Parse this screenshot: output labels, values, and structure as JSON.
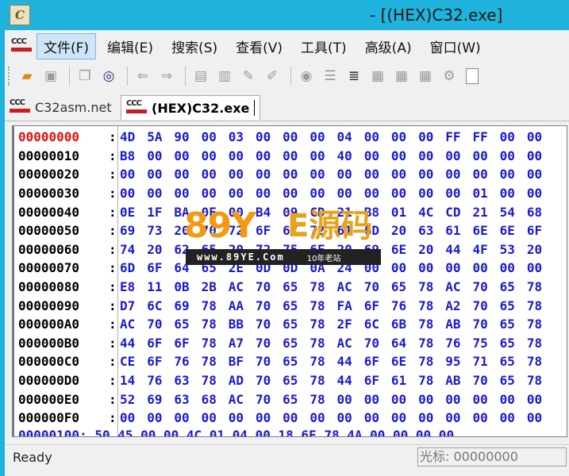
{
  "window": {
    "title": "- [(HEX)C32.exe]",
    "icon": "app-icon"
  },
  "menu": {
    "items": [
      "文件(F)",
      "编辑(E)",
      "搜索(S)",
      "查看(V)",
      "工具(T)",
      "高级(A)",
      "窗口(W)"
    ],
    "active_index": 0
  },
  "toolbar": {
    "icons": [
      "open-folder-icon",
      "save-icon",
      "copy-icon",
      "binoculars-icon",
      "back-arrow-icon",
      "forward-arrow-icon",
      "page-icon",
      "page-icon",
      "tools-icon",
      "tools-icon",
      "clipboard-icon",
      "list-icon",
      "align-icon",
      "grid-icon",
      "grid-icon",
      "grid-icon",
      "gear-icon"
    ]
  },
  "tabs": [
    {
      "label": "C32asm.net",
      "active": false
    },
    {
      "label": "(HEX)C32.exe",
      "active": true
    }
  ],
  "hex": {
    "rows": [
      {
        "addr": "00000000",
        "bytes": [
          "4D",
          "5A",
          "90",
          "00",
          "03",
          "00",
          "00",
          "00",
          "04",
          "00",
          "00",
          "00",
          "FF",
          "FF",
          "00",
          "00"
        ]
      },
      {
        "addr": "00000010",
        "bytes": [
          "B8",
          "00",
          "00",
          "00",
          "00",
          "00",
          "00",
          "00",
          "40",
          "00",
          "00",
          "00",
          "00",
          "00",
          "00",
          "00"
        ]
      },
      {
        "addr": "00000020",
        "bytes": [
          "00",
          "00",
          "00",
          "00",
          "00",
          "00",
          "00",
          "00",
          "00",
          "00",
          "00",
          "00",
          "00",
          "00",
          "00",
          "00"
        ]
      },
      {
        "addr": "00000030",
        "bytes": [
          "00",
          "00",
          "00",
          "00",
          "00",
          "00",
          "00",
          "00",
          "00",
          "00",
          "00",
          "00",
          "00",
          "01",
          "00",
          "00"
        ]
      },
      {
        "addr": "00000040",
        "bytes": [
          "0E",
          "1F",
          "BA",
          "0E",
          "00",
          "B4",
          "09",
          "CD",
          "21",
          "B8",
          "01",
          "4C",
          "CD",
          "21",
          "54",
          "68"
        ]
      },
      {
        "addr": "00000050",
        "bytes": [
          "69",
          "73",
          "20",
          "70",
          "72",
          "6F",
          "67",
          "72",
          "61",
          "6D",
          "20",
          "63",
          "61",
          "6E",
          "6E",
          "6F"
        ]
      },
      {
        "addr": "00000060",
        "bytes": [
          "74",
          "20",
          "62",
          "65",
          "20",
          "72",
          "75",
          "6E",
          "20",
          "69",
          "6E",
          "20",
          "44",
          "4F",
          "53",
          "20"
        ]
      },
      {
        "addr": "00000070",
        "bytes": [
          "6D",
          "6F",
          "64",
          "65",
          "2E",
          "0D",
          "0D",
          "0A",
          "24",
          "00",
          "00",
          "00",
          "00",
          "00",
          "00",
          "00"
        ]
      },
      {
        "addr": "00000080",
        "bytes": [
          "E8",
          "11",
          "0B",
          "2B",
          "AC",
          "70",
          "65",
          "78",
          "AC",
          "70",
          "65",
          "78",
          "AC",
          "70",
          "65",
          "78"
        ]
      },
      {
        "addr": "00000090",
        "bytes": [
          "D7",
          "6C",
          "69",
          "78",
          "AA",
          "70",
          "65",
          "78",
          "FA",
          "6F",
          "76",
          "78",
          "A2",
          "70",
          "65",
          "78"
        ]
      },
      {
        "addr": "000000A0",
        "bytes": [
          "AC",
          "70",
          "65",
          "78",
          "BB",
          "70",
          "65",
          "78",
          "2F",
          "6C",
          "6B",
          "78",
          "AB",
          "70",
          "65",
          "78"
        ]
      },
      {
        "addr": "000000B0",
        "bytes": [
          "44",
          "6F",
          "6F",
          "78",
          "A7",
          "70",
          "65",
          "78",
          "AC",
          "70",
          "64",
          "78",
          "76",
          "75",
          "65",
          "78"
        ]
      },
      {
        "addr": "000000C0",
        "bytes": [
          "CE",
          "6F",
          "76",
          "78",
          "BF",
          "70",
          "65",
          "78",
          "44",
          "6F",
          "6E",
          "78",
          "95",
          "71",
          "65",
          "78"
        ]
      },
      {
        "addr": "000000D0",
        "bytes": [
          "14",
          "76",
          "63",
          "78",
          "AD",
          "70",
          "65",
          "78",
          "44",
          "6F",
          "61",
          "78",
          "AB",
          "70",
          "65",
          "78"
        ]
      },
      {
        "addr": "000000E0",
        "bytes": [
          "52",
          "69",
          "63",
          "68",
          "AC",
          "70",
          "65",
          "78",
          "00",
          "00",
          "00",
          "00",
          "00",
          "00",
          "00",
          "00"
        ]
      },
      {
        "addr": "000000F0",
        "bytes": [
          "00",
          "00",
          "00",
          "00",
          "00",
          "00",
          "00",
          "00",
          "00",
          "00",
          "00",
          "00",
          "00",
          "00",
          "00",
          "00"
        ]
      }
    ],
    "partial_row": "00000100: 50 45 00 00 4C 01 04 00 18 6F 78 4A 00 00 00 00"
  },
  "watermark": {
    "logo": "89Y",
    "logo_cn": "E源码",
    "url": "www.89YE.Com",
    "slogan": "10年老站"
  },
  "status": {
    "left": "Ready",
    "right": "光标: 00000000"
  },
  "colors": {
    "titlebar": "#1fb3de",
    "address_active": "#e01010",
    "bytes": "#1a1acc"
  }
}
